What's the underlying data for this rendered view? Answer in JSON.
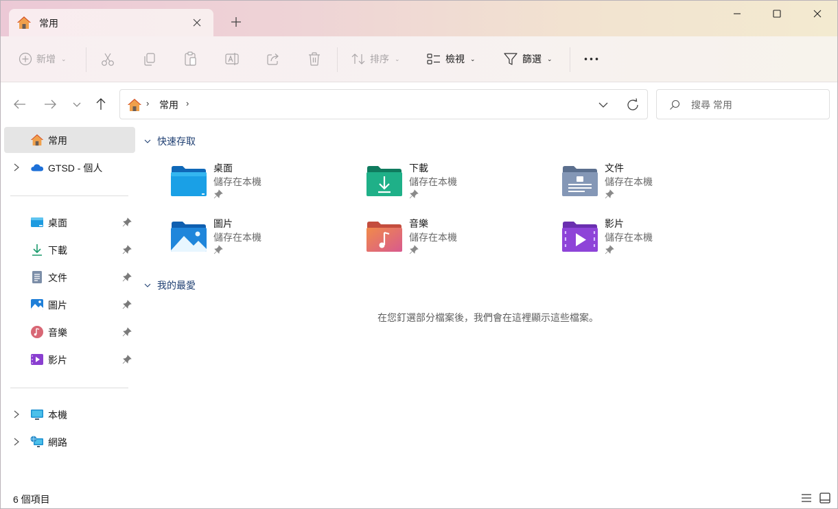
{
  "tab": {
    "title": "常用"
  },
  "toolbar": {
    "new_label": "新增",
    "sort_label": "排序",
    "view_label": "檢視",
    "filter_label": "篩選"
  },
  "address": {
    "crumb": "常用"
  },
  "search": {
    "placeholder": "搜尋 常用"
  },
  "sidebar": {
    "home": "常用",
    "onedrive": "GTSD - 個人",
    "pinned": [
      "桌面",
      "下載",
      "文件",
      "圖片",
      "音樂",
      "影片"
    ],
    "this_pc": "本機",
    "network": "網路"
  },
  "main": {
    "quick_access_header": "快速存取",
    "favorites_header": "我的最愛",
    "location_text": "儲存在本機",
    "folders": [
      {
        "name": "桌面",
        "icon": "desktop-folder-icon"
      },
      {
        "name": "下載",
        "icon": "downloads-folder-icon"
      },
      {
        "name": "文件",
        "icon": "documents-folder-icon"
      },
      {
        "name": "圖片",
        "icon": "pictures-folder-icon"
      },
      {
        "name": "音樂",
        "icon": "music-folder-icon"
      },
      {
        "name": "影片",
        "icon": "videos-folder-icon"
      }
    ],
    "favorites_empty": "在您釘選部分檔案後，我們會在這裡顯示這些檔案。"
  },
  "statusbar": {
    "item_count": "6 個項目"
  },
  "colors": {
    "accent_text": "#1f3f72",
    "selection": "#e5e5e5"
  }
}
